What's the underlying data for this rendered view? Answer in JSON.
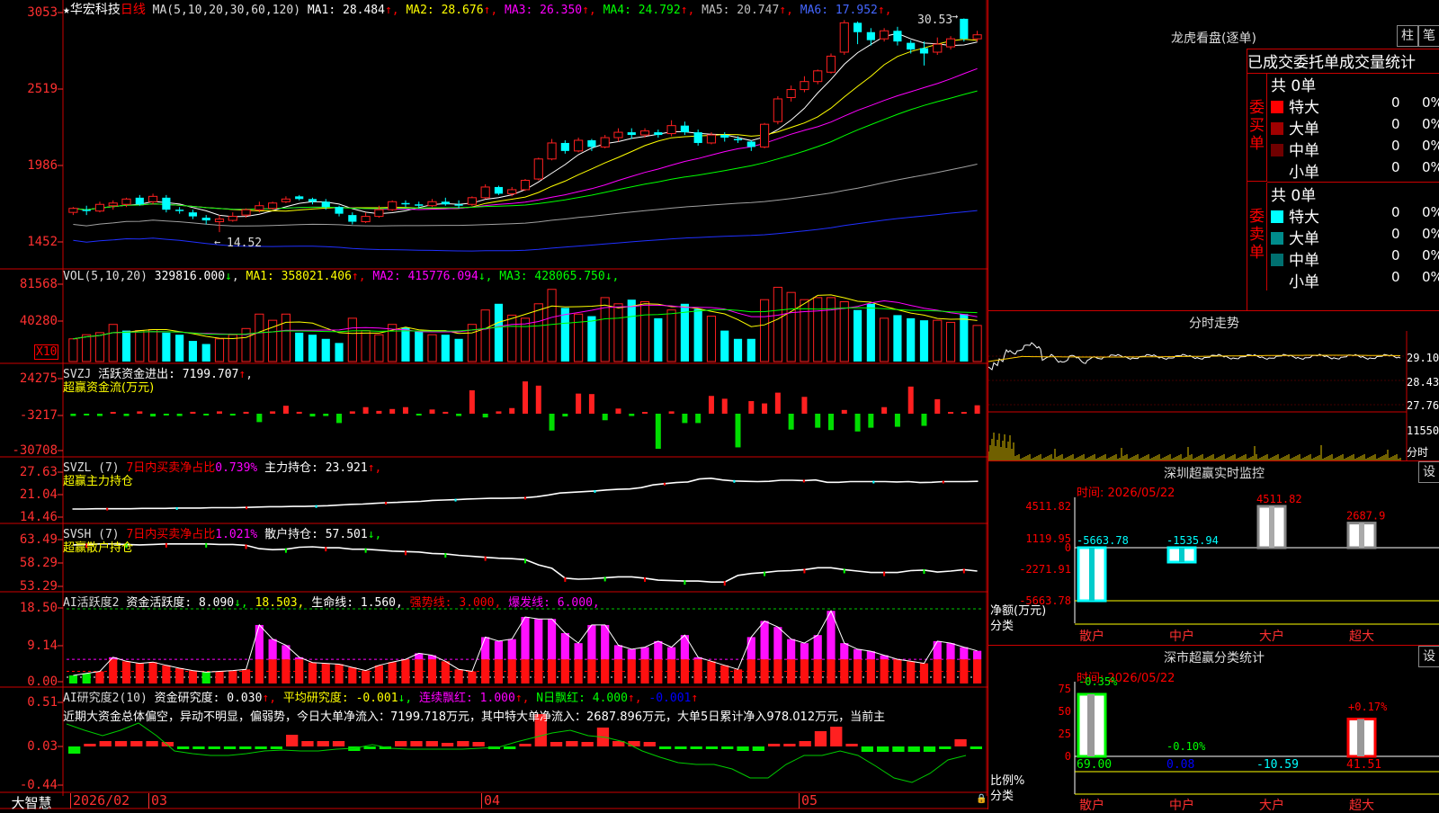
{
  "app": {
    "stock_name": "华宏科技",
    "period": "日线",
    "star": "★",
    "brand": "大智慧"
  },
  "kline_panel": {
    "ma_params": "MA(5,10,20,30,60,120)",
    "ma_values": [
      {
        "label": "MA1:",
        "value": "28.484",
        "arrow": "↑",
        "color": "#ffffff"
      },
      {
        "label": "MA2:",
        "value": "28.676",
        "arrow": "↑",
        "color": "#ffff00"
      },
      {
        "label": "MA3:",
        "value": "26.350",
        "arrow": "↑",
        "color": "#ff00ff"
      },
      {
        "label": "MA4:",
        "value": "24.792",
        "arrow": "↑",
        "color": "#00ff00"
      },
      {
        "label": "MA5:",
        "value": "20.747",
        "arrow": "↑",
        "color": "#c0c0c0"
      },
      {
        "label": "MA6:",
        "value": "17.952",
        "arrow": "↑",
        "color": "#0000ff"
      }
    ],
    "y_ticks": [
      "3053",
      "2519",
      "1986",
      "1452"
    ],
    "high_label": "30.53",
    "low_label": "14.52"
  },
  "vol_panel": {
    "params": "VOL(5,10,20)",
    "value": "329816.000",
    "value_arrow": "↓",
    "ma": [
      {
        "label": "MA1:",
        "value": "358021.406",
        "arrow": "↑",
        "color": "#ffff00"
      },
      {
        "label": "MA2:",
        "value": "415776.094",
        "arrow": "↓",
        "color": "#ff00ff"
      },
      {
        "label": "MA3:",
        "value": "428065.750",
        "arrow": "↓",
        "color": "#00ff00"
      }
    ],
    "y_ticks": [
      "81568",
      "40280"
    ],
    "unit": "X10"
  },
  "svzj_panel": {
    "name": "SVZJ",
    "label": "活跃资金进出:",
    "value": "7199.707",
    "arrow": "↑",
    "sub": "超赢资金流(万元)",
    "y_ticks": [
      "24275",
      "-3217",
      "-30708"
    ]
  },
  "svzl_panel": {
    "name": "SVZL (7)",
    "label1": "7日内买卖净占比",
    "value1": "0.739%",
    "label2": "主力持仓:",
    "value2": "23.921",
    "arrow": "↑,",
    "sub": "超赢主力持仓",
    "y_ticks": [
      "27.63",
      "21.04",
      "14.46"
    ]
  },
  "svsh_panel": {
    "name": "SVSH (7)",
    "label1": "7日内买卖净占比",
    "value1": "1.021%",
    "label2": "散户持仓:",
    "value2": "57.501",
    "arrow": "↓,",
    "sub": "超赢散户持仓",
    "y_ticks": [
      "63.49",
      "58.29",
      "53.29"
    ]
  },
  "ai_active_panel": {
    "name": "AI活跃度2",
    "label": "资金活跃度:",
    "value": "8.090",
    "arrow": "↓,",
    "v2": "18.503,",
    "life_label": "生命线:",
    "life_value": "1.560,",
    "strong_label": "强势线:",
    "strong_value": "3.000,",
    "burst_label": "爆发线:",
    "burst_value": "6.000,",
    "y_ticks": [
      "18.50",
      "9.14",
      "0.00"
    ]
  },
  "ai_research_panel": {
    "name": "AI研究度2(10)",
    "label": "资金研究度:",
    "value": "0.030",
    "arrow": "↑,",
    "avg_label": "平均研究度:",
    "avg_value": "-0.001",
    "avg_arrow": "↓,",
    "cont_label": "连续飘红:",
    "cont_value": "1.000",
    "cont_arrow": "↑,",
    "n_label": "N日飘红:",
    "n_value": "4.000",
    "n_arrow": "↑,",
    "last_value": "-0.001",
    "last_arrow": "↑",
    "comment": "近期大资金总体偏空，异动不明显，偏弱势，今日大单净流入：7199.718万元，其中特大单净流入：2687.896万元，大单5日累计净入978.012万元，当前主",
    "y_ticks": [
      "0.51",
      "0.03",
      "-0.44"
    ]
  },
  "x_axis": [
    "2026/02",
    "03",
    "04",
    "05"
  ],
  "longhu": {
    "title": "龙虎看盘(逐单)",
    "btn_bar": "柱",
    "btn_pen": "笔",
    "header": "已成交委托单成交量统计",
    "buy_side_label": [
      "委",
      "买",
      "单"
    ],
    "sell_side_label": [
      "委",
      "卖",
      "单"
    ],
    "buy_total": "共 0单",
    "sell_total": "共 0单",
    "buy_rows": [
      {
        "name": "特大",
        "count": "0",
        "pct": "0%",
        "color": "#ff0000"
      },
      {
        "name": "大单",
        "count": "0",
        "pct": "0%",
        "color": "#a00000"
      },
      {
        "name": "中单",
        "count": "0",
        "pct": "0%",
        "color": "#700000"
      },
      {
        "name": "小单",
        "count": "0",
        "pct": "0%",
        "color": "#000000"
      }
    ],
    "sell_rows": [
      {
        "name": "特大",
        "count": "0",
        "pct": "0%",
        "color": "#00ffff"
      },
      {
        "name": "大单",
        "count": "0",
        "pct": "0%",
        "color": "#008c8c"
      },
      {
        "name": "中单",
        "count": "0",
        "pct": "0%",
        "color": "#007070"
      },
      {
        "name": "小单",
        "count": "0",
        "pct": "0%",
        "color": "#000000"
      }
    ]
  },
  "intraday": {
    "title": "分时走势",
    "prices": [
      "29.10",
      "28.43",
      "27.76"
    ],
    "vol": "11550",
    "label": "分时"
  },
  "sz_monitor": {
    "title": "深圳超赢实时监控",
    "btn": "设",
    "time": "时间: 2026/05/22",
    "y_ticks": [
      "4511.82",
      "1119.95",
      "0",
      "-2271.91",
      "-5663.78"
    ],
    "axis_label1": "净额(万元)",
    "axis_label2": "分类",
    "categories": [
      "散户",
      "中户",
      "大户",
      "超大"
    ],
    "values": [
      "-5663.78",
      "-1535.94",
      "4511.82",
      "2687.9"
    ]
  },
  "sz_class": {
    "title": "深市超赢分类统计",
    "btn": "设",
    "time": "时间: 2026/05/22",
    "y_ticks": [
      "75",
      "50",
      "25",
      "0"
    ],
    "axis_label1": "比例%",
    "axis_label2": "分类",
    "categories": [
      "散户",
      "中户",
      "大户",
      "超大"
    ],
    "top_labels": [
      "-0.35%",
      "-0.10%",
      "",
      "+0.17%"
    ],
    "values": [
      "69.00",
      "0.08",
      "-10.59",
      "41.51"
    ]
  },
  "chart_data": [
    {
      "type": "candlestick",
      "title": "华宏科技 日线",
      "x": [
        "2026/02",
        "03",
        "04",
        "05"
      ],
      "ylim": [
        14.52,
        30.53
      ],
      "candles": [
        [
          16.0,
          16.3,
          15.8,
          16.4
        ],
        [
          16.2,
          16.1,
          15.8,
          16.5
        ],
        [
          16.1,
          16.6,
          16.0,
          16.8
        ],
        [
          16.5,
          16.7,
          16.2,
          16.9
        ],
        [
          16.6,
          17.0,
          16.4,
          17.1
        ],
        [
          17.1,
          16.6,
          16.5,
          17.3
        ],
        [
          16.8,
          17.2,
          16.6,
          17.4
        ],
        [
          17.1,
          16.2,
          16.0,
          17.3
        ],
        [
          16.2,
          16.1,
          15.9,
          16.4
        ],
        [
          16.0,
          15.7,
          15.5,
          16.2
        ],
        [
          15.6,
          15.4,
          15.1,
          15.8
        ],
        [
          15.3,
          15.5,
          14.52,
          15.8
        ],
        [
          15.4,
          15.7,
          15.3,
          16.0
        ],
        [
          15.8,
          16.2,
          15.6,
          16.3
        ],
        [
          16.2,
          16.5,
          16.0,
          16.8
        ],
        [
          16.3,
          16.7,
          16.2,
          16.8
        ],
        [
          16.8,
          17.0,
          16.7,
          17.2
        ],
        [
          17.2,
          17.0,
          16.9,
          17.3
        ],
        [
          17.0,
          16.8,
          16.6,
          17.1
        ],
        [
          16.8,
          16.4,
          16.2,
          17.0
        ],
        [
          16.4,
          15.9,
          15.7,
          16.5
        ],
        [
          15.8,
          15.3,
          15.1,
          16.0
        ],
        [
          15.3,
          15.7,
          15.2,
          16.0
        ],
        [
          15.7,
          16.2,
          15.6,
          16.5
        ],
        [
          16.2,
          16.8,
          16.1,
          16.9
        ],
        [
          16.7,
          16.6,
          16.4,
          16.9
        ],
        [
          16.6,
          16.5,
          16.3,
          16.8
        ],
        [
          16.5,
          16.8,
          16.4,
          17.0
        ],
        [
          16.8,
          16.6,
          16.5,
          17.1
        ],
        [
          16.6,
          16.5,
          16.3,
          16.9
        ],
        [
          16.6,
          17.1,
          16.5,
          17.2
        ],
        [
          17.1,
          17.9,
          17.0,
          18.1
        ],
        [
          17.9,
          17.4,
          17.3,
          18.0
        ],
        [
          17.4,
          17.7,
          17.2,
          17.9
        ],
        [
          17.7,
          18.4,
          17.6,
          18.5
        ],
        [
          18.5,
          20.0,
          18.4,
          20.1
        ],
        [
          20.0,
          21.2,
          19.9,
          21.5
        ],
        [
          21.2,
          20.6,
          20.4,
          21.4
        ],
        [
          20.6,
          21.4,
          20.5,
          21.6
        ],
        [
          21.4,
          20.9,
          20.6,
          21.5
        ],
        [
          20.9,
          21.6,
          20.8,
          21.8
        ],
        [
          21.6,
          22.0,
          21.3,
          22.3
        ],
        [
          22.0,
          21.8,
          21.5,
          22.3
        ],
        [
          21.8,
          22.1,
          21.6,
          22.3
        ],
        [
          22.0,
          21.8,
          21.6,
          22.2
        ],
        [
          21.9,
          22.5,
          21.7,
          22.9
        ],
        [
          22.5,
          22.0,
          21.8,
          22.8
        ],
        [
          22.0,
          21.2,
          21.0,
          22.2
        ],
        [
          21.2,
          21.8,
          21.1,
          22.0
        ],
        [
          21.8,
          21.6,
          21.3,
          22.0
        ],
        [
          21.5,
          21.4,
          21.2,
          21.7
        ],
        [
          21.3,
          20.9,
          20.6,
          21.4
        ],
        [
          20.9,
          22.6,
          20.8,
          22.7
        ],
        [
          22.8,
          24.5,
          22.6,
          24.7
        ],
        [
          24.6,
          25.2,
          24.3,
          25.5
        ],
        [
          25.2,
          25.8,
          25.0,
          26.2
        ],
        [
          25.8,
          26.6,
          25.6,
          26.7
        ],
        [
          26.5,
          27.7,
          26.4,
          27.9
        ],
        [
          28.0,
          30.2,
          27.8,
          30.4
        ],
        [
          30.2,
          29.5,
          28.6,
          30.3
        ],
        [
          29.5,
          28.9,
          28.5,
          29.8
        ],
        [
          29.0,
          29.6,
          28.8,
          29.8
        ],
        [
          29.6,
          28.8,
          28.5,
          29.9
        ],
        [
          28.7,
          28.2,
          27.9,
          28.9
        ],
        [
          28.3,
          27.9,
          27.0,
          28.8
        ],
        [
          28.0,
          28.6,
          27.8,
          29.1
        ],
        [
          28.4,
          29.0,
          28.2,
          29.2
        ],
        [
          30.5,
          29.0,
          28.8,
          30.53
        ],
        [
          29.0,
          29.3,
          28.8,
          29.6
        ]
      ]
    },
    {
      "type": "bar",
      "title": "VOL(5,10,20)",
      "ylim": [
        0,
        81568
      ],
      "values": [
        22,
        26,
        28,
        36,
        30,
        30,
        31,
        28,
        26,
        20,
        17,
        22,
        26,
        32,
        46,
        40,
        46,
        28,
        26,
        22,
        18,
        42,
        30,
        26,
        36,
        33,
        29,
        26,
        26,
        22,
        36,
        50,
        56,
        45,
        42,
        56,
        70,
        52,
        46,
        44,
        62,
        56,
        60,
        58,
        42,
        50,
        56,
        51,
        44,
        30,
        22,
        22,
        60,
        72,
        67,
        60,
        62,
        62,
        58,
        50,
        56,
        42,
        45,
        42,
        40,
        40,
        38,
        46,
        35
      ],
      "up": [
        1,
        1,
        1,
        1,
        0,
        1,
        1,
        0,
        0,
        0,
        0,
        1,
        1,
        1,
        1,
        1,
        1,
        0,
        0,
        0,
        0,
        1,
        1,
        1,
        1,
        0,
        0,
        1,
        0,
        0,
        1,
        1,
        0,
        1,
        1,
        1,
        1,
        0,
        1,
        0,
        1,
        1,
        0,
        1,
        0,
        1,
        0,
        0,
        1,
        0,
        0,
        0,
        1,
        1,
        1,
        1,
        1,
        1,
        1,
        0,
        0,
        1,
        0,
        0,
        0,
        1,
        1,
        0,
        1
      ]
    },
    {
      "type": "bar",
      "title": "SVZJ 活跃资金进出",
      "ylim": [
        -30708,
        24275
      ],
      "values": [
        -0.5,
        -0.3,
        -0.5,
        0.3,
        -0.5,
        0.5,
        -0.6,
        -0.3,
        -0.5,
        0.4,
        -0.3,
        0.5,
        -0.4,
        0.4,
        -1.8,
        0.5,
        1.7,
        0.4,
        -0.6,
        -0.5,
        -2.0,
        0.5,
        1.4,
        0.6,
        1.0,
        1.4,
        -0.4,
        0.9,
        0.4,
        -0.5,
        5.0,
        -0.8,
        0.5,
        1.2,
        6.9,
        6.0,
        -3.6,
        -0.6,
        4.3,
        4.2,
        -1.4,
        1.1,
        -0.5,
        0.3,
        -7.5,
        0.5,
        -2.0,
        -2.0,
        3.8,
        3.2,
        -7.2,
        2.7,
        2.2,
        4.5,
        -3.4,
        3.6,
        -3.0,
        -3.5,
        0.8,
        -3.8,
        -3.0,
        1.4,
        -2.8,
        5.8,
        -2.6,
        3.1,
        0.0,
        0.0,
        1.8
      ],
      "scale_unit": 1000
    },
    {
      "type": "line",
      "title": "SVZL 主力持仓",
      "ylim": [
        14.46,
        27.63
      ],
      "values": [
        16.6,
        16.6,
        16.7,
        16.7,
        16.7,
        16.7,
        16.8,
        16.8,
        16.8,
        16.9,
        16.9,
        16.9,
        17.0,
        17.0,
        17.0,
        17.1,
        17.2,
        17.3,
        17.3,
        17.4,
        17.4,
        17.5,
        17.6,
        17.8,
        18.0,
        18.1,
        18.3,
        18.5,
        18.6,
        18.8,
        18.9,
        19.2,
        19.3,
        19.4,
        19.6,
        19.7,
        19.8,
        19.8,
        19.9,
        20.0,
        20.3,
        20.8,
        21.4,
        21.6,
        21.8,
        22.0,
        22.3,
        22.5,
        22.6,
        23.0,
        23.8,
        24.2,
        24.5,
        24.7,
        25.6,
        25.8,
        25.3,
        25.0,
        24.9,
        24.8,
        24.9,
        25.2,
        25.2,
        25.1,
        25.3,
        24.6,
        24.6,
        24.8,
        24.8,
        24.8,
        24.8,
        24.7,
        24.8,
        24.5,
        24.6,
        24.8,
        24.8,
        24.8,
        24.9
      ]
    },
    {
      "type": "line",
      "title": "SVSH 散户持仓",
      "ylim": [
        53.29,
        63.49
      ],
      "values": [
        62.0,
        62.1,
        62.2,
        62.2,
        62.1,
        62.0,
        62.1,
        62.2,
        62.2,
        62.2,
        62.2,
        62.1,
        62.1,
        61.9,
        61.2,
        61.0,
        61.1,
        61.5,
        61.6,
        61.4,
        61.4,
        61.1,
        61.1,
        60.9,
        60.7,
        60.6,
        60.5,
        60.2,
        60.1,
        59.8,
        59.6,
        59.4,
        59.2,
        59.1,
        58.9,
        57.8,
        57.1,
        55.0,
        54.8,
        54.9,
        55.1,
        55.3,
        55.3,
        55.0,
        54.6,
        54.5,
        54.4,
        54.4,
        54.2,
        54.2,
        55.6,
        56.0,
        56.2,
        56.5,
        56.6,
        56.8,
        57.2,
        57.2,
        56.8,
        56.5,
        56.2,
        56.2,
        56.2,
        56.6,
        56.7,
        56.3,
        56.5,
        56.8,
        56.5
      ]
    },
    {
      "type": "bar",
      "title": "AI活跃度2",
      "ylim": [
        0,
        18.5
      ],
      "values": [
        2.0,
        2.5,
        3.0,
        6.5,
        5.5,
        5.0,
        5.3,
        4.5,
        3.8,
        3.2,
        2.8,
        3.0,
        3.2,
        3.5,
        14.5,
        11.0,
        9.5,
        6.5,
        5.2,
        5.0,
        4.8,
        4.0,
        3.2,
        4.5,
        5.3,
        6.0,
        7.5,
        7.0,
        5.5,
        3.5,
        3.0,
        11.5,
        10.5,
        11.0,
        16.5,
        16.0,
        16.0,
        12.5,
        10.0,
        14.5,
        14.5,
        9.5,
        8.5,
        9.0,
        10.5,
        9.0,
        12.0,
        6.5,
        5.5,
        4.5,
        3.5,
        11.5,
        15.5,
        14.0,
        11.0,
        10.0,
        12.0,
        18.0,
        10.0,
        8.5,
        8.0,
        7.0,
        6.0,
        5.5,
        5.0,
        10.5,
        10.0,
        9.0,
        8.1
      ]
    },
    {
      "type": "bar",
      "title": "AI研究度2(10)",
      "ylim": [
        -0.44,
        0.51
      ],
      "values": [
        -0.08,
        0.03,
        0.06,
        0.06,
        0.06,
        0.06,
        0.05,
        -0.03,
        -0.03,
        -0.03,
        -0.03,
        -0.03,
        -0.03,
        -0.03,
        0.13,
        0.06,
        0.06,
        0.06,
        -0.05,
        -0.03,
        -0.03,
        0.06,
        0.06,
        0.06,
        0.04,
        0.06,
        0.05,
        -0.03,
        -0.03,
        0.03,
        0.36,
        0.05,
        0.06,
        0.05,
        0.21,
        0.06,
        0.06,
        0.05,
        -0.03,
        -0.03,
        -0.03,
        -0.03,
        -0.03,
        -0.05,
        -0.05,
        0.02,
        0.02,
        0.06,
        0.17,
        0.22,
        0.02,
        -0.06,
        -0.06,
        -0.06,
        -0.06,
        -0.06,
        -0.03,
        0.08,
        -0.03
      ],
      "line": [
        0.25,
        0.18,
        0.12,
        0.18,
        0.26,
        0.12,
        -0.05,
        -0.08,
        -0.1,
        -0.1,
        -0.08,
        -0.05,
        -0.04,
        -0.05,
        -0.05,
        -0.03,
        -0.02,
        0.02,
        -0.02,
        -0.03,
        -0.03,
        -0.03,
        -0.03,
        -0.02,
        -0.01,
        0.05,
        0.1,
        0.15,
        0.18,
        0.12,
        0.1,
        0.05,
        -0.05,
        -0.12,
        -0.18,
        -0.2,
        -0.2,
        -0.25,
        -0.35,
        -0.35,
        -0.2,
        -0.1,
        -0.1,
        -0.05,
        -0.1,
        -0.22,
        -0.35,
        -0.4,
        -0.3,
        -0.15,
        -0.1
      ]
    }
  ]
}
